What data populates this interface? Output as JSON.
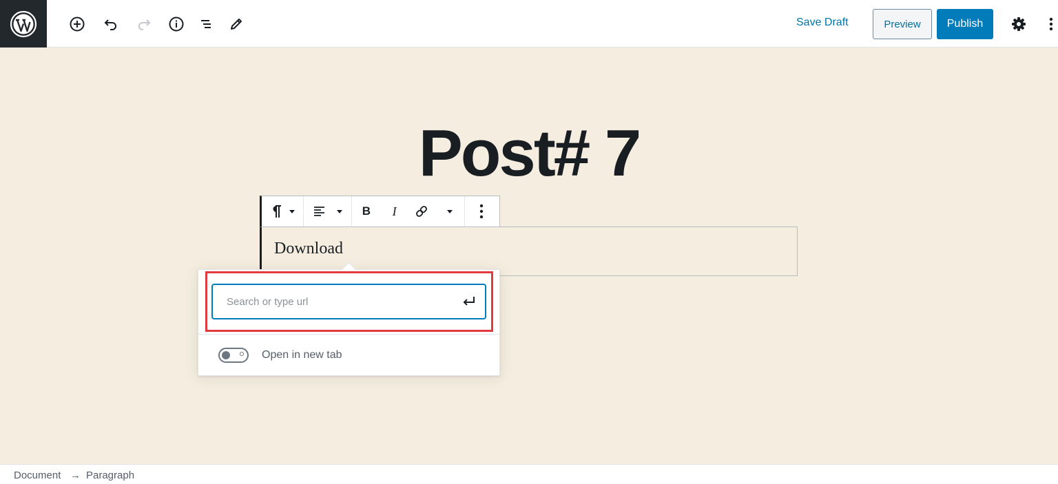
{
  "header": {
    "toolbar_icons": [
      "wordpress-logo-icon",
      "add-block-icon",
      "undo-icon",
      "redo-icon",
      "info-icon",
      "block-navigation-icon",
      "tools-pencil-icon"
    ],
    "save_draft_label": "Save Draft",
    "preview_label": "Preview",
    "publish_label": "Publish",
    "settings_icon": "gear-icon",
    "more_icon": "vertical-ellipsis-icon"
  },
  "editor": {
    "post_title": "Post# 7",
    "block_toolbar": {
      "buttons": [
        "paragraph-icon",
        "align-left-icon",
        "bold-icon",
        "italic-icon",
        "link-icon",
        "more-rich-text-controls-icon",
        "more-options-icon"
      ],
      "bold_glyph": "B",
      "italic_glyph": "I"
    },
    "paragraph_text": "Download"
  },
  "link_popover": {
    "search_placeholder": "Search or type url",
    "search_value": "",
    "submit_icon": "enter-return-icon",
    "open_new_tab_label": "Open in new tab",
    "open_new_tab_checked": false
  },
  "footer": {
    "breadcrumb": [
      "Document",
      "Paragraph"
    ],
    "separator": "→"
  },
  "colors": {
    "background": "#f5eee0",
    "accent": "#007cba",
    "highlight": "#e0393e",
    "logo_bg": "#23282d"
  }
}
